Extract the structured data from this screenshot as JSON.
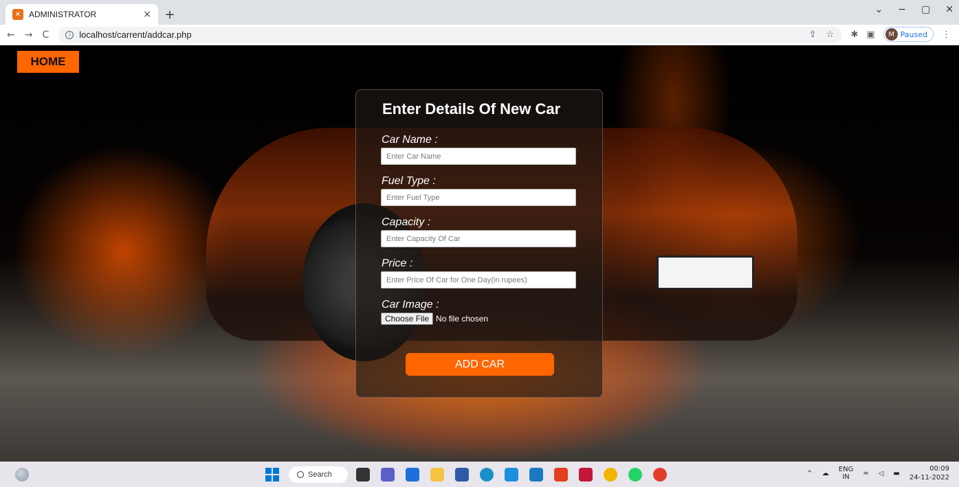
{
  "browser": {
    "tab_title": "ADMINISTRATOR",
    "tab_favicon": "xampp-icon",
    "tab_close": "×",
    "new_tab": "+",
    "url": "localhost/carrent/addcar.php",
    "profile_initial": "M",
    "profile_status": "Paused",
    "window_controls": {
      "minimize": "−",
      "maximize": "▢",
      "close": "✕",
      "dropdown": "⌄"
    }
  },
  "page": {
    "home_button": "HOME",
    "form": {
      "title": "Enter Details Of New Car",
      "fields": [
        {
          "label": "Car Name :",
          "placeholder": "Enter Car Name",
          "value": ""
        },
        {
          "label": "Fuel Type :",
          "placeholder": "Enter Fuel Type",
          "value": ""
        },
        {
          "label": "Capacity :",
          "placeholder": "Enter Capacity Of Car",
          "value": ""
        },
        {
          "label": "Price :",
          "placeholder": "Enter Price Of Car for One Day(in rupees)",
          "value": ""
        }
      ],
      "image_label": "Car Image :",
      "choose_file": "Choose File",
      "no_file": "No file chosen",
      "submit": "ADD CAR"
    },
    "accent_color": "#ff6600"
  },
  "taskbar": {
    "search_label": "Search",
    "tray": {
      "lang_top": "ENG",
      "lang_bottom": "IN",
      "time": "00:09",
      "date": "24-11-2022"
    },
    "icons": [
      "start-icon",
      "search-icon",
      "taskview-icon",
      "teams-icon",
      "desktop-icon",
      "file-explorer-icon",
      "store-icon",
      "edge-icon",
      "app-icon",
      "l-app-icon",
      "office-icon",
      "mcafee-icon",
      "chrome-icon",
      "whatsapp-icon",
      "chrome-profile-icon"
    ]
  }
}
